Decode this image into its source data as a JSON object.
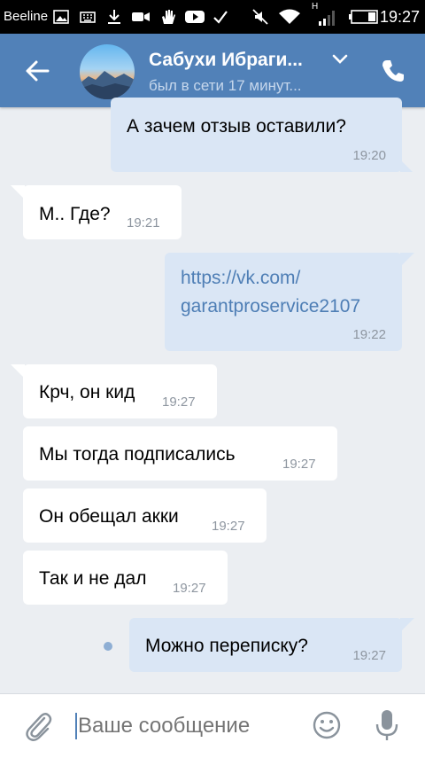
{
  "statusbar": {
    "carrier": "Beeline",
    "time": "19:27",
    "network_letter": "H"
  },
  "header": {
    "name": "Сабухи Ибраги...",
    "last_seen": "был в сети 17 минут..."
  },
  "messages": [
    {
      "dir": "out",
      "text": "А зачем отзыв оставили?",
      "time": "19:20"
    },
    {
      "dir": "in",
      "text": "М.. Где?",
      "time": "19:21"
    },
    {
      "dir": "out",
      "link_line1": "https://vk.com/",
      "link_line2": "garantproservice2107",
      "time": "19:22"
    },
    {
      "dir": "in",
      "text": "Крч, он кид",
      "time": "19:27"
    },
    {
      "dir": "in",
      "text": "Мы тогда подписались",
      "time": "19:27"
    },
    {
      "dir": "in",
      "text": "Он обещал акки",
      "time": "19:27"
    },
    {
      "dir": "in",
      "text": "Так и не дал",
      "time": "19:27"
    },
    {
      "dir": "out",
      "text": "Можно переписку?",
      "time": "19:27",
      "unread": true
    }
  ],
  "composer": {
    "placeholder": "Ваше сообщение"
  },
  "colors": {
    "header": "#5181b8",
    "outgoing": "#dae6f5",
    "incoming": "#ffffff",
    "background": "#ebeef2"
  }
}
